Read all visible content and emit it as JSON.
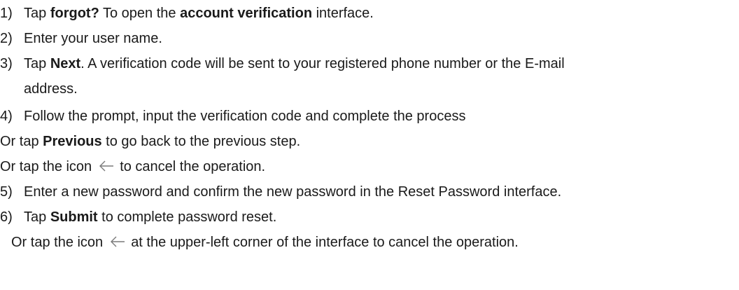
{
  "steps": [
    {
      "num": "1)",
      "pre": "Tap ",
      "b1": "forgot?",
      "mid": " To open the ",
      "b2": "account verification",
      "post": " interface."
    },
    {
      "num": "2)",
      "text": "Enter your user name."
    },
    {
      "num": "3)",
      "pre": "Tap ",
      "b1": "Next",
      "post": ". A verification code will be sent to your registered phone number or the E-mail",
      "cont": "address."
    },
    {
      "num": "4)",
      "text": "Follow the prompt, input the verification code and complete the process"
    },
    {
      "num": "5)",
      "text": "Enter a new password and confirm the new password in the Reset Password interface."
    },
    {
      "num": "6)",
      "pre": "Tap ",
      "b1": "Submit",
      "post": " to complete password reset."
    }
  ],
  "alt_previous": {
    "pre": "Or tap ",
    "b1": "Previous",
    "post": " to go back to the previous step."
  },
  "alt_cancel_1": {
    "pre": "Or tap the icon",
    "post": "to cancel the operation."
  },
  "alt_cancel_2": {
    "pre": "Or tap the icon",
    "post": "at the upper-left corner of the interface to cancel the operation."
  },
  "icons": {
    "back": "back-arrow-icon"
  },
  "colors": {
    "text": "#1a1a1a",
    "icon": "#7a7a7a"
  }
}
